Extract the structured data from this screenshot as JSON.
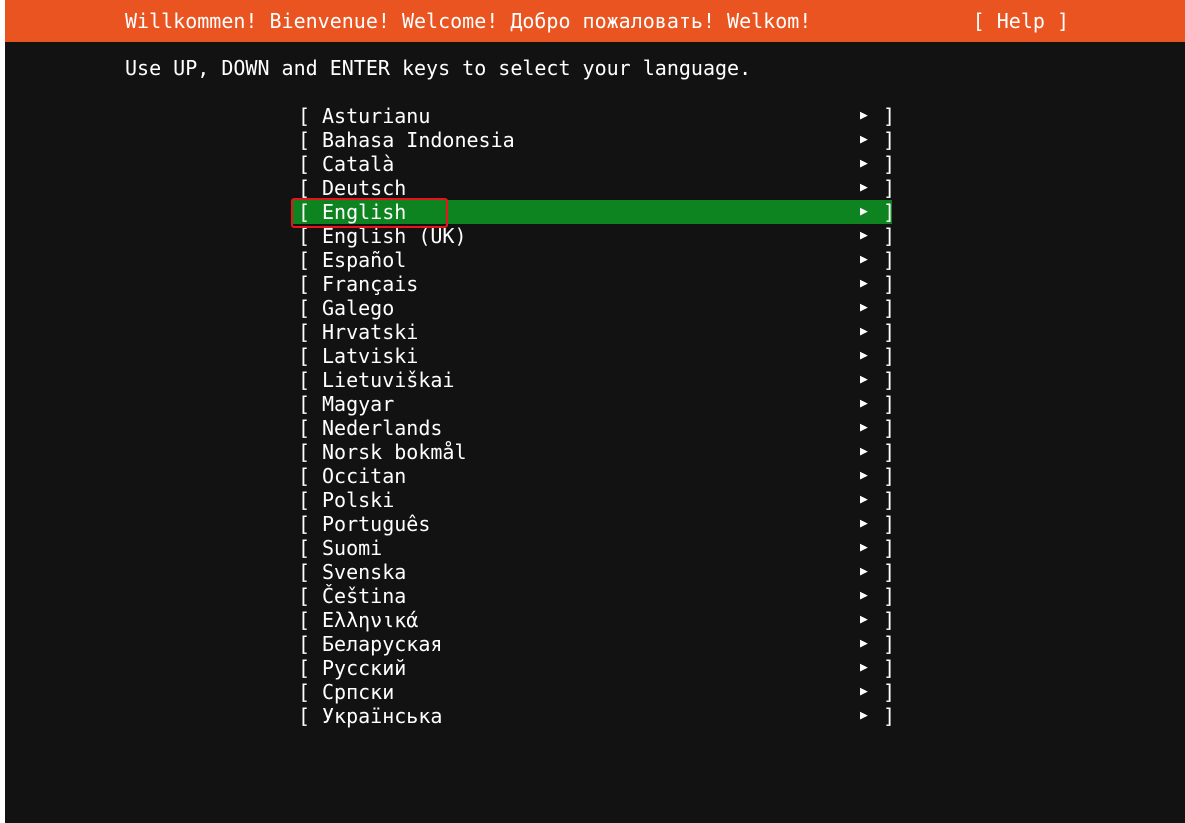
{
  "header": {
    "title": "Willkommen! Bienvenue! Welcome! Добро пожаловать! Welkom!",
    "help_label": "[ Help ]"
  },
  "instructions": "Use UP, DOWN and ENTER keys to select your language.",
  "colors": {
    "header_bg": "#e95420",
    "screen_bg": "#121212",
    "selected_bg": "#0e8420",
    "focus_outline": "#e8141c"
  },
  "list_glyphs": {
    "open": "[",
    "close": "]",
    "arrow": "▶"
  },
  "selected_index": 4,
  "languages": [
    {
      "label": "Asturianu"
    },
    {
      "label": "Bahasa Indonesia"
    },
    {
      "label": "Català"
    },
    {
      "label": "Deutsch"
    },
    {
      "label": "English"
    },
    {
      "label": "English (UK)"
    },
    {
      "label": "Español"
    },
    {
      "label": "Français"
    },
    {
      "label": "Galego"
    },
    {
      "label": "Hrvatski"
    },
    {
      "label": "Latviski"
    },
    {
      "label": "Lietuviškai"
    },
    {
      "label": "Magyar"
    },
    {
      "label": "Nederlands"
    },
    {
      "label": "Norsk bokmål"
    },
    {
      "label": "Occitan"
    },
    {
      "label": "Polski"
    },
    {
      "label": "Português"
    },
    {
      "label": "Suomi"
    },
    {
      "label": "Svenska"
    },
    {
      "label": "Čeština"
    },
    {
      "label": "Ελληνικά"
    },
    {
      "label": "Беларуская"
    },
    {
      "label": "Русский"
    },
    {
      "label": "Српски"
    },
    {
      "label": "Українська"
    }
  ]
}
